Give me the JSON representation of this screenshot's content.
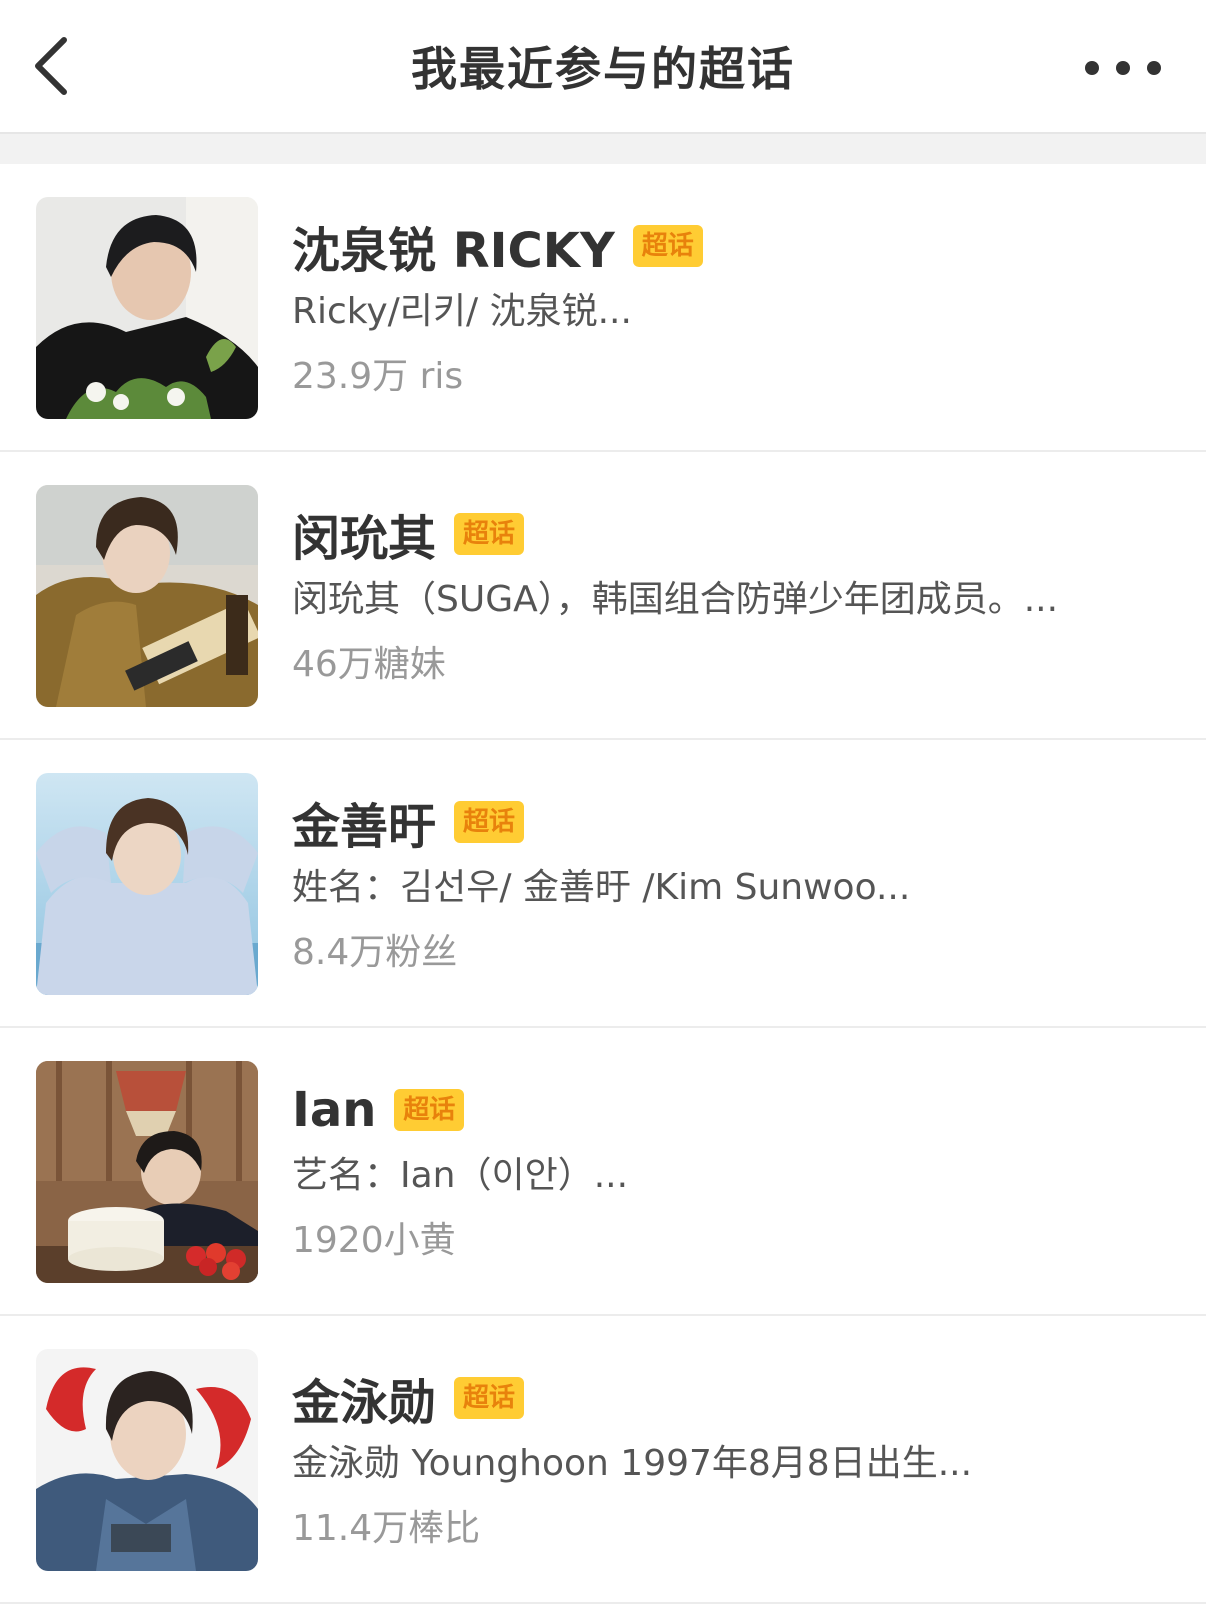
{
  "header": {
    "title": "我最近参与的超话",
    "back_icon": "chevron-left-icon",
    "more_icon": "more-dots-icon"
  },
  "topics": [
    {
      "name": "沈泉锐 RICKY",
      "badge": "超话",
      "desc": "Ricky/리키/ 沈泉锐...",
      "fans": "23.9万 ris"
    },
    {
      "name": "闵玧其",
      "badge": "超话",
      "desc": "闵玧其（SUGA），韩国组合防弹少年团成员。...",
      "fans": "46万糖妹"
    },
    {
      "name": "金善旴",
      "badge": "超话",
      "desc": "姓名：김선우/ 金善旴 /Kim Sunwoo...",
      "fans": "8.4万粉丝"
    },
    {
      "name": "Ian",
      "badge": "超话",
      "desc": "艺名：Ian（이안）...",
      "fans": "1920小黄"
    },
    {
      "name": "金泳勋",
      "badge": "超话",
      "desc": "金泳勋 Younghoon 1997年8月8日出生...",
      "fans": "11.4万棒比"
    }
  ],
  "colors": {
    "badge_bg": "#ffcc33",
    "badge_text": "#e8820c",
    "title_text": "#333333",
    "fans_text": "#999999"
  }
}
